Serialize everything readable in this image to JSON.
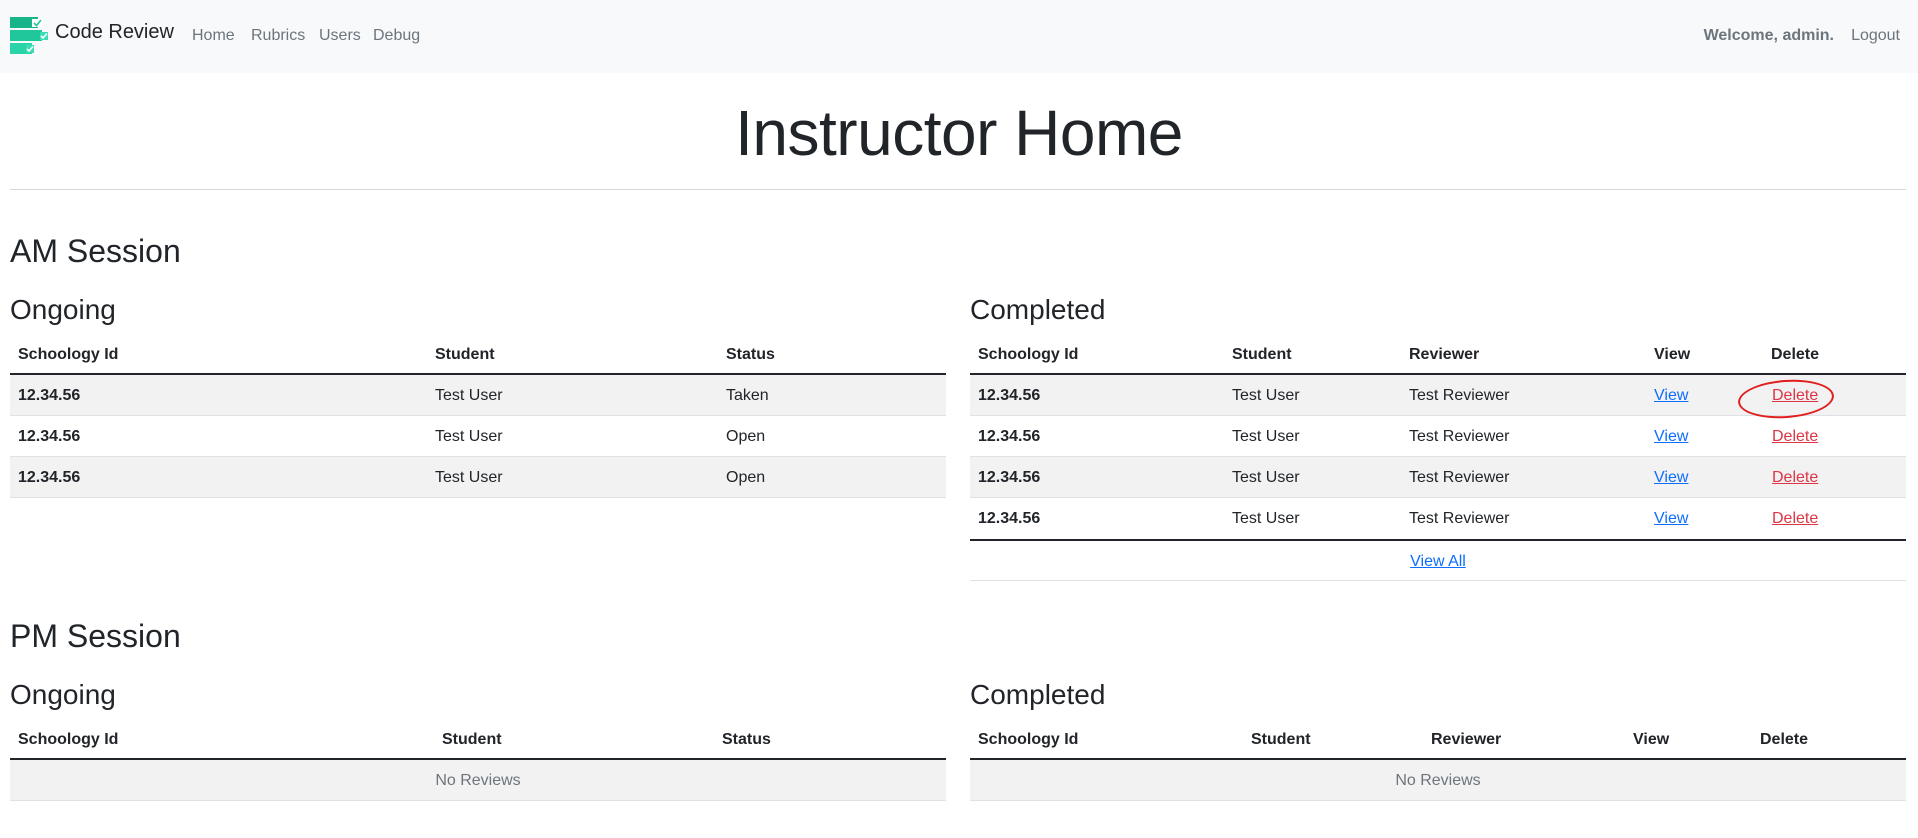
{
  "navbar": {
    "brand": "Code Review",
    "links": [
      "Home",
      "Rubrics",
      "Users",
      "Debug"
    ],
    "welcome": "Welcome, admin.",
    "logout": "Logout",
    "brand_colors": [
      "#1dbf94",
      "#37d9b0"
    ]
  },
  "page": {
    "title": "Instructor Home"
  },
  "am": {
    "title": "AM Session",
    "ongoing": {
      "title": "Ongoing",
      "headers": [
        "Schoology Id",
        "Student",
        "Status"
      ],
      "rows": [
        [
          "12.34.56",
          "Test User",
          "Taken"
        ],
        [
          "12.34.56",
          "Test User",
          "Open"
        ],
        [
          "12.34.56",
          "Test User",
          "Open"
        ]
      ]
    },
    "completed": {
      "title": "Completed",
      "headers": [
        "Schoology Id",
        "Student",
        "Reviewer",
        "View",
        "Delete"
      ],
      "rows": [
        [
          "12.34.56",
          "Test User",
          "Test Reviewer",
          "View",
          "Delete"
        ],
        [
          "12.34.56",
          "Test User",
          "Test Reviewer",
          "View",
          "Delete"
        ],
        [
          "12.34.56",
          "Test User",
          "Test Reviewer",
          "View",
          "Delete"
        ],
        [
          "12.34.56",
          "Test User",
          "Test Reviewer",
          "View",
          "Delete"
        ]
      ],
      "view_all": "View All"
    }
  },
  "pm": {
    "title": "PM Session",
    "ongoing": {
      "title": "Ongoing",
      "headers": [
        "Schoology Id",
        "Student",
        "Status"
      ],
      "empty": "No Reviews"
    },
    "completed": {
      "title": "Completed",
      "headers": [
        "Schoology Id",
        "Student",
        "Reviewer",
        "View",
        "Delete"
      ],
      "empty": "No Reviews"
    }
  },
  "colors": {
    "link": "#0d6efd",
    "danger": "#dc3545",
    "annotation": "#e01e1e"
  }
}
